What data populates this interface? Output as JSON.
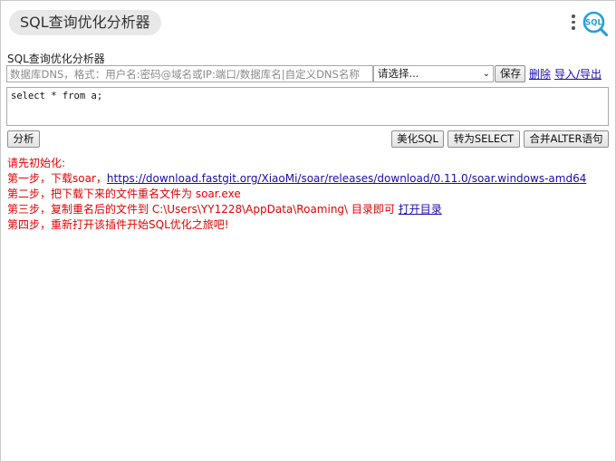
{
  "header": {
    "title": "SQL查询优化分析器"
  },
  "connection": {
    "section_label": "SQL查询优化分析器",
    "input_placeholder": "数据库DNS，格式：用户名:密码@域名或IP:端口/数据库名|自定义DNS名称",
    "select_value": "请选择...",
    "save_label": "保存",
    "delete_label": "删除",
    "import_export_label": "导入/导出"
  },
  "editor": {
    "sql": "select * from a;"
  },
  "toolbar": {
    "analyze_label": "分析",
    "beautify_label": "美化SQL",
    "to_select_label": "转为SELECT",
    "merge_alter_label": "合并ALTER语句"
  },
  "messages": {
    "init_title": "请先初始化:",
    "step1_prefix": "第一步，下载soar，",
    "step1_link": "https://download.fastgit.org/XiaoMi/soar/releases/download/0.11.0/soar.windows-amd64",
    "step2": "第二步，把下载下来的文件重名文件为 soar.exe",
    "step3_prefix": "第三步，复制重名后的文件到 C:\\Users\\YY1228\\AppData\\Roaming\\ 目录即可 ",
    "step3_link": "打开目录",
    "step4": "第四步，重新打开该插件开始SQL优化之旅吧!"
  },
  "colors": {
    "error_text": "#e60000",
    "link": "#1a0dab",
    "logo": "#2a9fd6"
  },
  "icons": {
    "menu": "kebab-menu-icon",
    "logo": "sql-search-logo-icon"
  }
}
